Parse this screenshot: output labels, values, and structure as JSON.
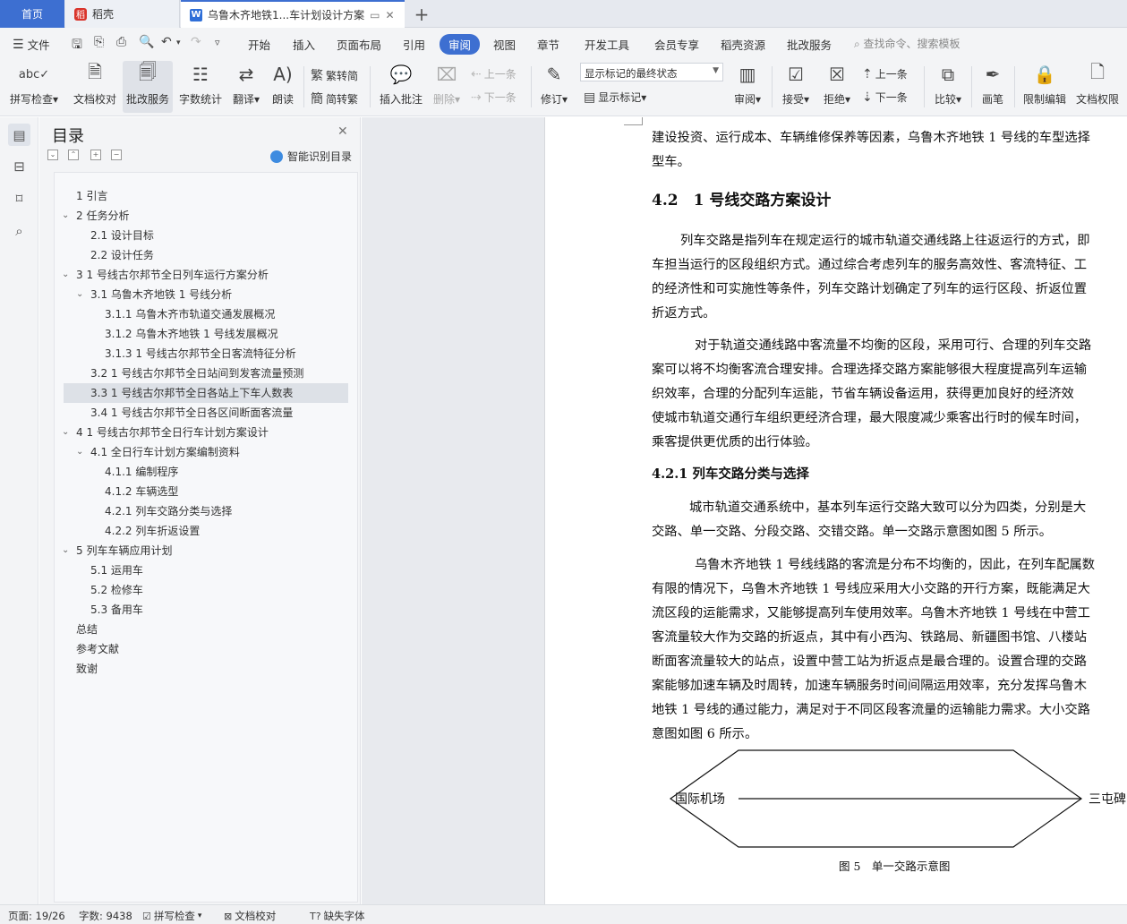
{
  "tabs": {
    "home": "首页",
    "daoke": "稻壳",
    "doc_title": "乌鲁木齐地铁1...车计划设计方案",
    "plus": "+"
  },
  "menu": {
    "file": "文件",
    "items": [
      "开始",
      "插入",
      "页面布局",
      "引用",
      "审阅",
      "视图",
      "章节",
      "开发工具",
      "会员专享",
      "稻壳资源",
      "批改服务"
    ],
    "search": "查找命令、搜索模板"
  },
  "ribbon": {
    "spell": "拼写检查",
    "proof": "文档校对",
    "correct": "批改服务",
    "wordcount": "字数统计",
    "translate": "翻译",
    "read": "朗读",
    "trad": "繁转简",
    "simp": "简转繁",
    "insert_comment": "插入批注",
    "delete": "删除",
    "prev": "上一条",
    "next": "下一条",
    "revise": "修订",
    "markup_state": "显示标记的最终状态",
    "show_markup": "显示标记",
    "review": "审阅",
    "accept": "接受",
    "reject": "拒绝",
    "prev2": "上一条",
    "next2": "下一条",
    "compare": "比较",
    "pen": "画笔",
    "restrict": "限制编辑",
    "permission": "文档权限"
  },
  "toc": {
    "title": "目录",
    "smart": "智能识别目录",
    "items": [
      {
        "level": 1,
        "text": "1 引言",
        "caret": ""
      },
      {
        "level": 1,
        "text": "2 任务分析",
        "caret": "⌄"
      },
      {
        "level": 2,
        "text": "2.1 设计目标",
        "caret": ""
      },
      {
        "level": 2,
        "text": "2.2 设计任务",
        "caret": ""
      },
      {
        "level": 1,
        "text": "3 1 号线古尔邦节全日列车运行方案分析",
        "caret": "⌄"
      },
      {
        "level": 2,
        "text": "3.1 乌鲁木齐地铁 1 号线分析",
        "caret": "⌄"
      },
      {
        "level": 3,
        "text": "3.1.1 乌鲁木齐市轨道交通发展概况",
        "caret": ""
      },
      {
        "level": 3,
        "text": "3.1.2 乌鲁木齐地铁 1 号线发展概况",
        "caret": ""
      },
      {
        "level": 3,
        "text": "3.1.3 1 号线古尔邦节全日客流特征分析",
        "caret": ""
      },
      {
        "level": 2,
        "text": "3.2 1 号线古尔邦节全日站间到发客流量预测",
        "caret": ""
      },
      {
        "level": 2,
        "text": "3.3 1 号线古尔邦节全日各站上下车人数表",
        "caret": "",
        "selected": true
      },
      {
        "level": 2,
        "text": "3.4 1 号线古尔邦节全日各区间断面客流量",
        "caret": ""
      },
      {
        "level": 1,
        "text": "4 1 号线古尔邦节全日行车计划方案设计",
        "caret": "⌄"
      },
      {
        "level": 2,
        "text": "4.1 全日行车计划方案编制资料",
        "caret": "⌄"
      },
      {
        "level": 3,
        "text": "4.1.1 编制程序",
        "caret": ""
      },
      {
        "level": 3,
        "text": "4.1.2 车辆选型",
        "caret": ""
      },
      {
        "level": 3,
        "text": "4.2.1 列车交路分类与选择",
        "caret": ""
      },
      {
        "level": 3,
        "text": "4.2.2 列车折返设置",
        "caret": ""
      },
      {
        "level": 1,
        "text": "5 列车车辆应用计划",
        "caret": "⌄"
      },
      {
        "level": 2,
        "text": "5.1 运用车",
        "caret": ""
      },
      {
        "level": 2,
        "text": "5.2 检修车",
        "caret": ""
      },
      {
        "level": 2,
        "text": "5.3 备用车",
        "caret": ""
      },
      {
        "level": 1,
        "text": "总结",
        "caret": ""
      },
      {
        "level": 1,
        "text": "参考文献",
        "caret": ""
      },
      {
        "level": 1,
        "text": "致谢",
        "caret": ""
      }
    ]
  },
  "document": {
    "lines": [
      "建设投资、运行成本、车辆维修保养等因素，乌鲁木齐地铁 1 号线的车型选择",
      "型车。",
      "4.2　1 号线交路方案设计",
      "列车交路是指列车在规定运行的城市轨道交通线路上往返运行的方式，即",
      "车担当运行的区段组织方式。通过综合考虑列车的服务高效性、客流特征、工",
      "的经济性和可实施性等条件，列车交路计划确定了列车的运行区段、折返位置",
      "折返方式。",
      "对于轨道交通线路中客流量不均衡的区段，采用可行、合理的列车交路",
      "案可以将不均衡客流合理安排。合理选择交路方案能够很大程度提高列车运输",
      "织效率，合理的分配列车运能，节省车辆设备运用，获得更加良好的经济效",
      "使城市轨道交通行车组织更经济合理，最大限度减少乘客出行时的候车时间，",
      "乘客提供更优质的出行体验。",
      "4.2.1 列车交路分类与选择",
      "城市轨道交通系统中，基本列车运行交路大致可以分为四类，分别是大",
      "交路、单一交路、分段交路、交错交路。单一交路示意图如图 5 所示。",
      "乌鲁木齐地铁 1 号线线路的客流是分布不均衡的，因此，在列车配属数",
      "有限的情况下，乌鲁木齐地铁 1 号线应采用大小交路的开行方案，既能满足大",
      "流区段的运能需求，又能够提高列车使用效率。乌鲁木齐地铁 1 号线在中营工",
      "客流量较大作为交路的折返点，其中有小西沟、铁路局、新疆图书馆、八楼站",
      "断面客流量较大的站点，设置中营工站为折返点是最合理的。设置合理的交路",
      "案能够加速车辆及时周转，加速车辆服务时间间隔运用效率，充分发挥乌鲁木",
      "地铁 1 号线的通过能力，满足对于不同区段客流量的运输能力需求。大小交路",
      "意图如图 6 所示。"
    ],
    "figure": {
      "left_label": "国际机场",
      "right_label": "三屯碑",
      "caption": "图 5　单一交路示意图"
    }
  },
  "status": {
    "page": "页面: 19/26",
    "words": "字数: 9438",
    "spell": "拼写检查",
    "proof": "文档校对",
    "missing_font": "缺失字体"
  }
}
